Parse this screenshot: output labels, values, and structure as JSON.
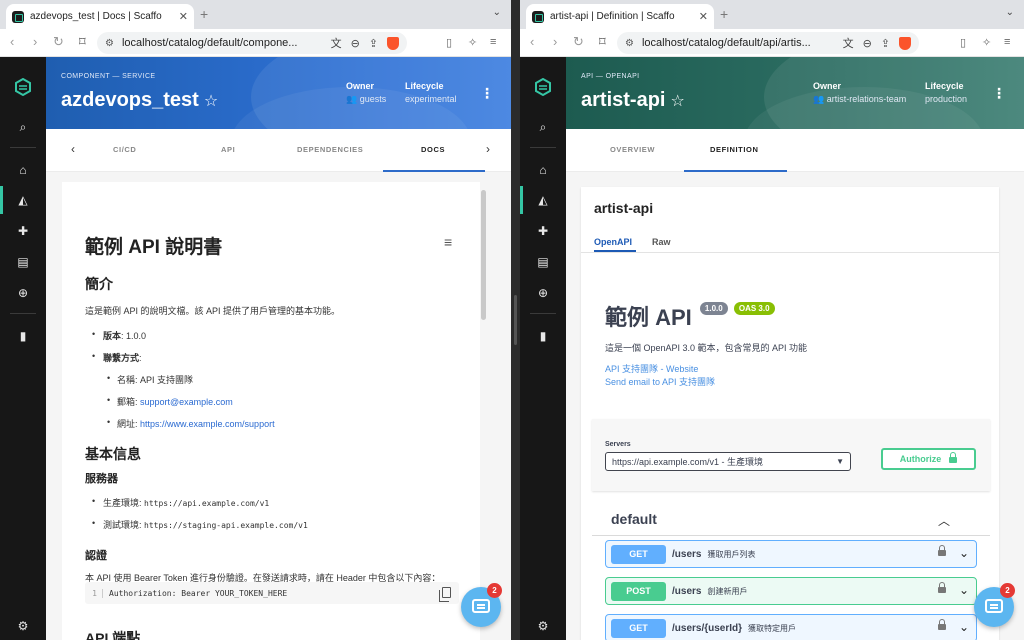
{
  "left": {
    "tab_title": "azdevops_test | Docs | Scaffo",
    "url": "localhost/catalog/default/compone...",
    "kind": "COMPONENT — SERVICE",
    "entity_name": "azdevops_test",
    "owner_label": "Owner",
    "owner_value": "guests",
    "lifecycle_label": "Lifecycle",
    "lifecycle_value": "experimental",
    "tabs": [
      "CI/CD",
      "API",
      "DEPENDENCIES",
      "DOCS"
    ],
    "active_tab": "DOCS",
    "doc": {
      "title": "範例 API 說明書",
      "intro_heading": "簡介",
      "intro_text": "這是範例 API 的說明文檔。該 API 提供了用戶管理的基本功能。",
      "version_label": "版本",
      "version_value": ": 1.0.0",
      "contact_label": "聯繫方式",
      "contact_suffix": ":",
      "contact_name": "名稱: API 支持團隊",
      "email_label": "郵箱: ",
      "email_value": "support@example.com",
      "site_label": "網址: ",
      "site_value": "https://www.example.com/support",
      "basic_heading": "基本信息",
      "servers_heading": "服務器",
      "prod_label": "生產環境: ",
      "prod_url": "https://api.example.com/v1",
      "staging_label": "測試環境: ",
      "staging_url": "https://staging-api.example.com/v1",
      "auth_heading": "認證",
      "auth_text": "本 API 使用 Bearer Token 進行身份驗證。在發送請求時，請在 Header 中包含以下內容：",
      "code_line_no": "1",
      "code": "Authorization: Bearer YOUR_TOKEN_HERE",
      "endpoints_heading": "API 端點"
    },
    "badge_count": "2"
  },
  "right": {
    "tab_title": "artist-api | Definition | Scaffo",
    "url": "localhost/catalog/default/api/artis...",
    "kind": "API — OPENAPI",
    "entity_name": "artist-api",
    "owner_label": "Owner",
    "owner_value": "artist-relations-team",
    "lifecycle_label": "Lifecycle",
    "lifecycle_value": "production",
    "tabs": [
      "OVERVIEW",
      "DEFINITION"
    ],
    "active_tab": "DEFINITION",
    "card_title": "artist-api",
    "card_tabs": [
      "OpenAPI",
      "Raw"
    ],
    "swagger": {
      "title": "範例 API",
      "version": "1.0.0",
      "oas": "OAS 3.0",
      "description": "這是一個 OpenAPI 3.0 範本，包含常見的 API 功能",
      "link_website": "API 支持團隊 - Website",
      "link_email": "Send email to API 支持團隊",
      "servers_label": "Servers",
      "server_selected": "https://api.example.com/v1 - 生產環境",
      "authorize": "Authorize",
      "tag": "default",
      "operations": [
        {
          "method": "GET",
          "path": "/users",
          "summary": "獲取用戶列表"
        },
        {
          "method": "POST",
          "path": "/users",
          "summary": "創建新用戶"
        },
        {
          "method": "GET",
          "path": "/users/{userId}",
          "summary": "獲取特定用戶"
        }
      ]
    },
    "badge_count": "2"
  },
  "colors": {
    "backstage_accent": "#35c6a5",
    "header_blue": "#2d6fd2",
    "header_green": "#2d6e63",
    "swagger_get": "#61affe",
    "swagger_post": "#49cc90",
    "link": "#2a6ad1"
  },
  "icons": {
    "sidebar": [
      "backstage-logo-icon",
      "search-icon",
      "home-icon",
      "catalog-icon",
      "puzzle-icon",
      "docs-icon",
      "create-icon",
      "analytics-icon",
      "settings-icon"
    ]
  }
}
